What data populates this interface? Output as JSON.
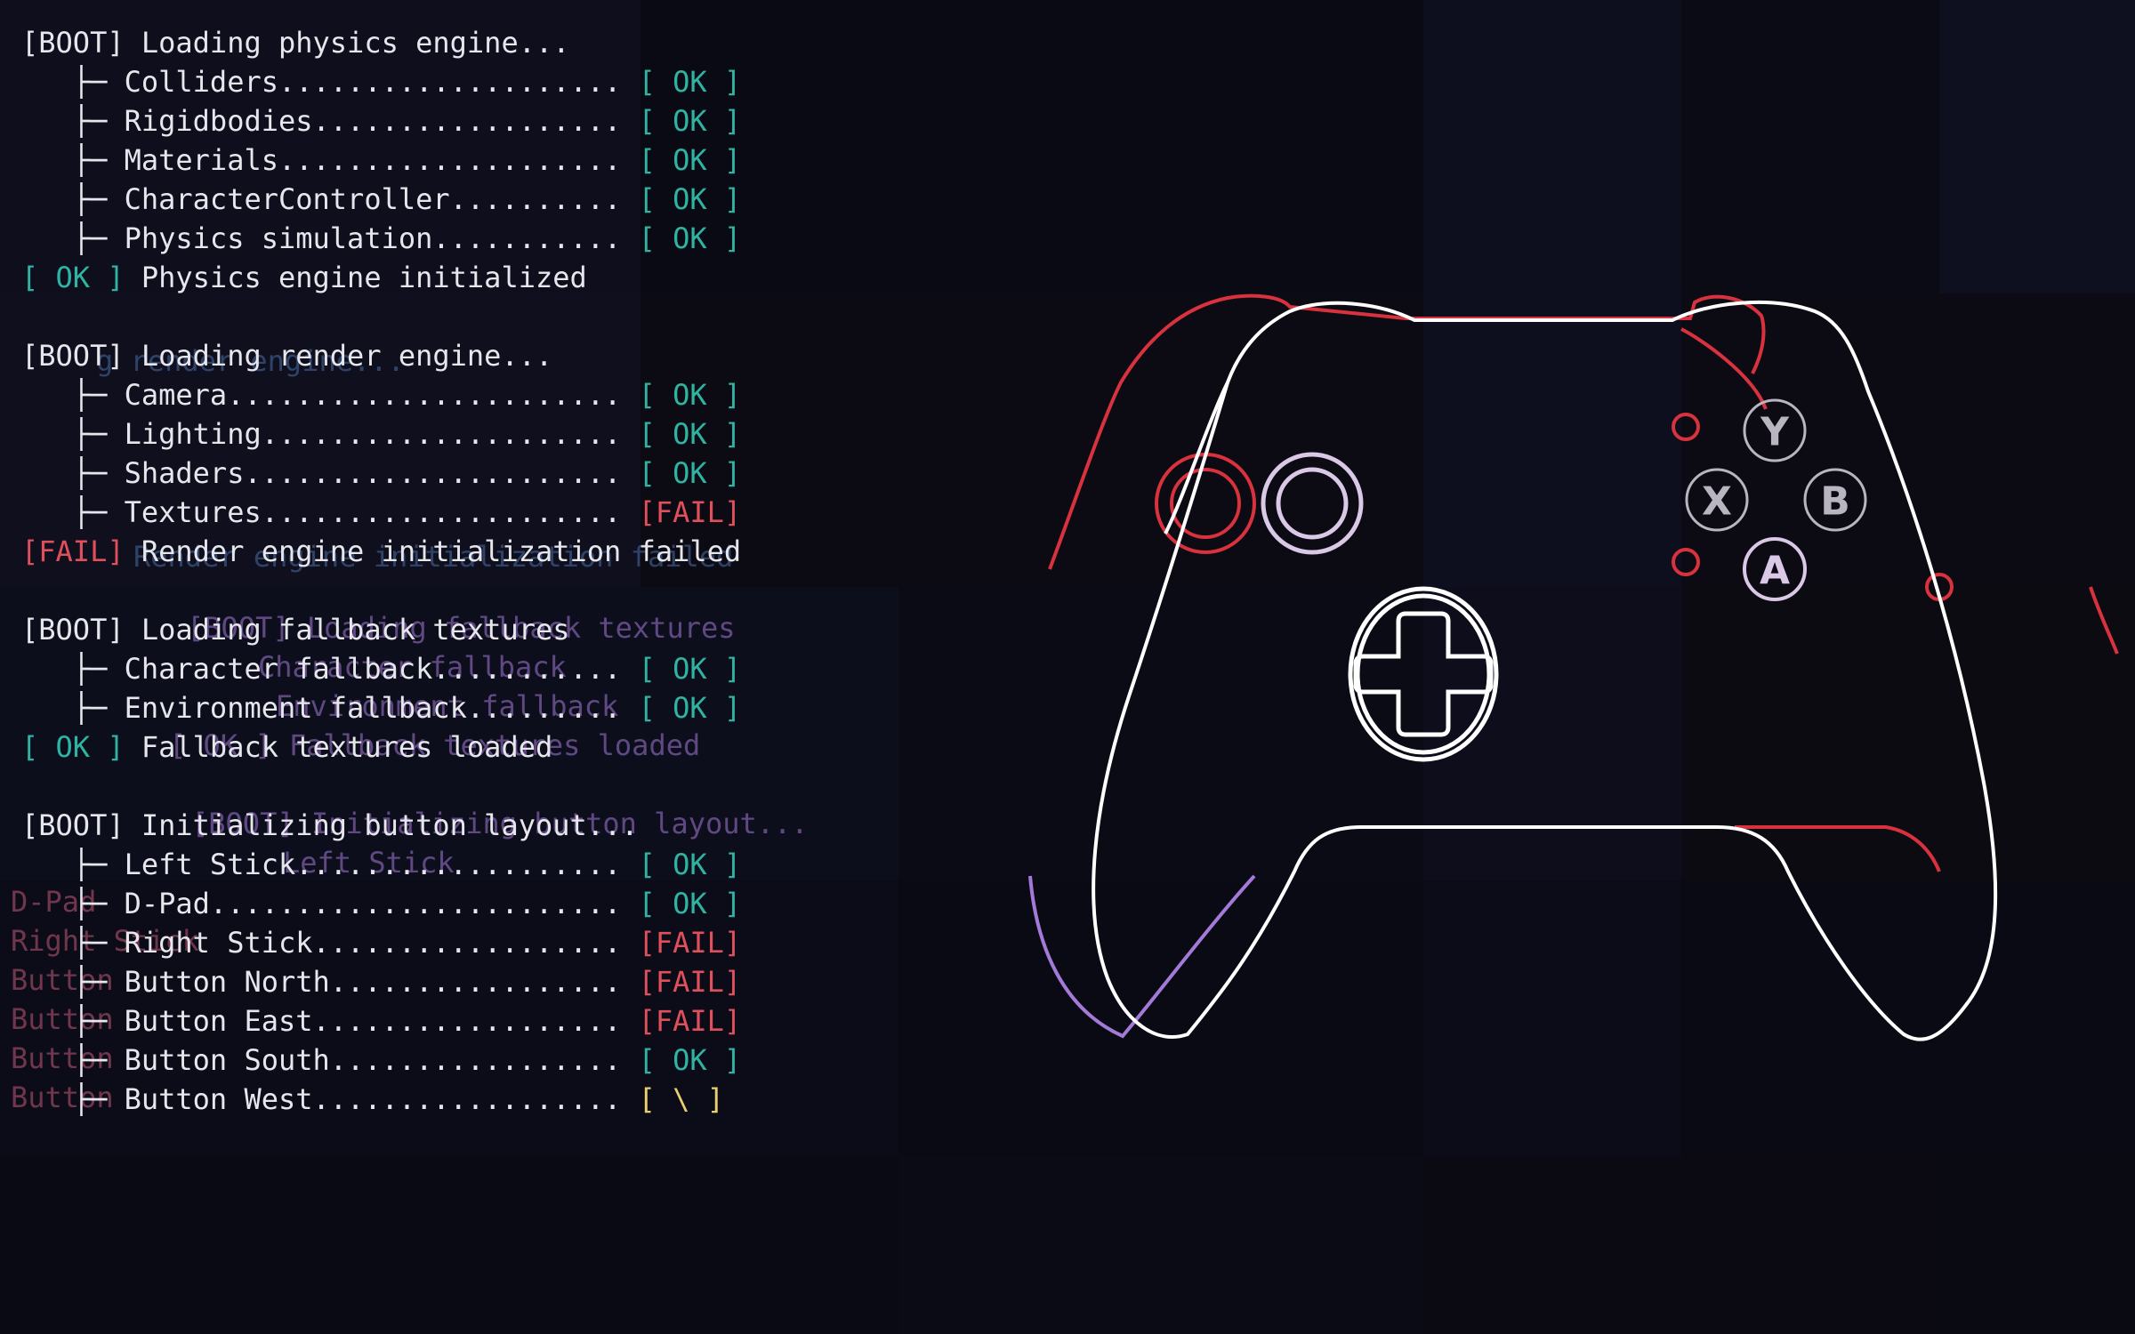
{
  "boot_log": [
    {
      "kind": "header",
      "prefix": "[BOOT]",
      "text": " Loading physics engine..."
    },
    {
      "kind": "item",
      "label": "Colliders",
      "status": "[ OK ]",
      "state": "ok"
    },
    {
      "kind": "item",
      "label": "Rigidbodies",
      "status": "[ OK ]",
      "state": "ok"
    },
    {
      "kind": "item",
      "label": "Materials",
      "status": "[ OK ]",
      "state": "ok"
    },
    {
      "kind": "item",
      "label": "CharacterController",
      "status": "[ OK ]",
      "state": "ok"
    },
    {
      "kind": "item",
      "label": "Physics simulation",
      "status": "[ OK ]",
      "state": "ok"
    },
    {
      "kind": "result",
      "prefix": "[ OK ]",
      "state": "ok",
      "text": " Physics engine initialized"
    },
    {
      "kind": "blank"
    },
    {
      "kind": "header",
      "prefix": "[BOOT]",
      "text": " Loading render engine..."
    },
    {
      "kind": "item",
      "label": "Camera",
      "status": "[ OK ]",
      "state": "ok"
    },
    {
      "kind": "item",
      "label": "Lighting",
      "status": "[ OK ]",
      "state": "ok"
    },
    {
      "kind": "item",
      "label": "Shaders",
      "status": "[ OK ]",
      "state": "ok"
    },
    {
      "kind": "item",
      "label": "Textures",
      "status": "[FAIL]",
      "state": "fail"
    },
    {
      "kind": "result",
      "prefix": "[FAIL]",
      "state": "fail",
      "text": " Render engine initialization failed"
    },
    {
      "kind": "blank"
    },
    {
      "kind": "header",
      "prefix": "[BOOT]",
      "text": " Loading fallback textures"
    },
    {
      "kind": "item",
      "label": "Character fallback",
      "status": "[ OK ]",
      "state": "ok"
    },
    {
      "kind": "item",
      "label": "Environment fallback",
      "status": "[ OK ]",
      "state": "ok"
    },
    {
      "kind": "result",
      "prefix": "[ OK ]",
      "state": "ok",
      "text": " Fallback textures loaded"
    },
    {
      "kind": "blank"
    },
    {
      "kind": "header",
      "prefix": "[BOOT]",
      "text": " Initializing button layout..."
    },
    {
      "kind": "item",
      "label": "Left Stick",
      "status": "[ OK ]",
      "state": "ok"
    },
    {
      "kind": "item",
      "label": "D-Pad",
      "status": "[ OK ]",
      "state": "ok"
    },
    {
      "kind": "item",
      "label": "Right Stick",
      "status": "[FAIL]",
      "state": "fail"
    },
    {
      "kind": "item",
      "label": "Button North",
      "status": "[FAIL]",
      "state": "fail"
    },
    {
      "kind": "item",
      "label": "Button East",
      "status": "[FAIL]",
      "state": "fail"
    },
    {
      "kind": "item",
      "label": "Button South",
      "status": "[ OK ]",
      "state": "ok"
    },
    {
      "kind": "item",
      "label": "Button West",
      "status": "[ \\ ]",
      "state": "warn"
    }
  ],
  "tree_prefix": "├─ ",
  "leader_char": ".",
  "ghosts": {
    "render_ghost": "g render engine...",
    "fallback_ghost": "[BOOT] Loading fallback textures",
    "fallback_result_ghost": "[ OK ] Fallback textures loaded",
    "layout_ghost": "[BOOT] Initializing button layout...",
    "fail_ghost": "Render engine initialization failed",
    "char_fallback_ghost": "Character fallback",
    "env_fallback_ghost": "Environment fallback",
    "left_stick_ghost": "Left Stick",
    "dpad_ghost": "D-Pad",
    "right_stick_ghost": "Right Stick",
    "button_ghost": "Button"
  },
  "controller": {
    "face_buttons": {
      "north": "Y",
      "west": "X",
      "east": "B",
      "south": "A"
    },
    "colors": {
      "outline": "#ffffff",
      "red_ghost": "#d8323e",
      "purple_ghost": "#a47ad8",
      "lilac": "#d9c8e6"
    }
  },
  "colors": {
    "background": "#0c0c18",
    "ok": "#2fb3a2",
    "fail": "#e0505c",
    "warn": "#e8d070",
    "text": "#e6e6ec"
  }
}
